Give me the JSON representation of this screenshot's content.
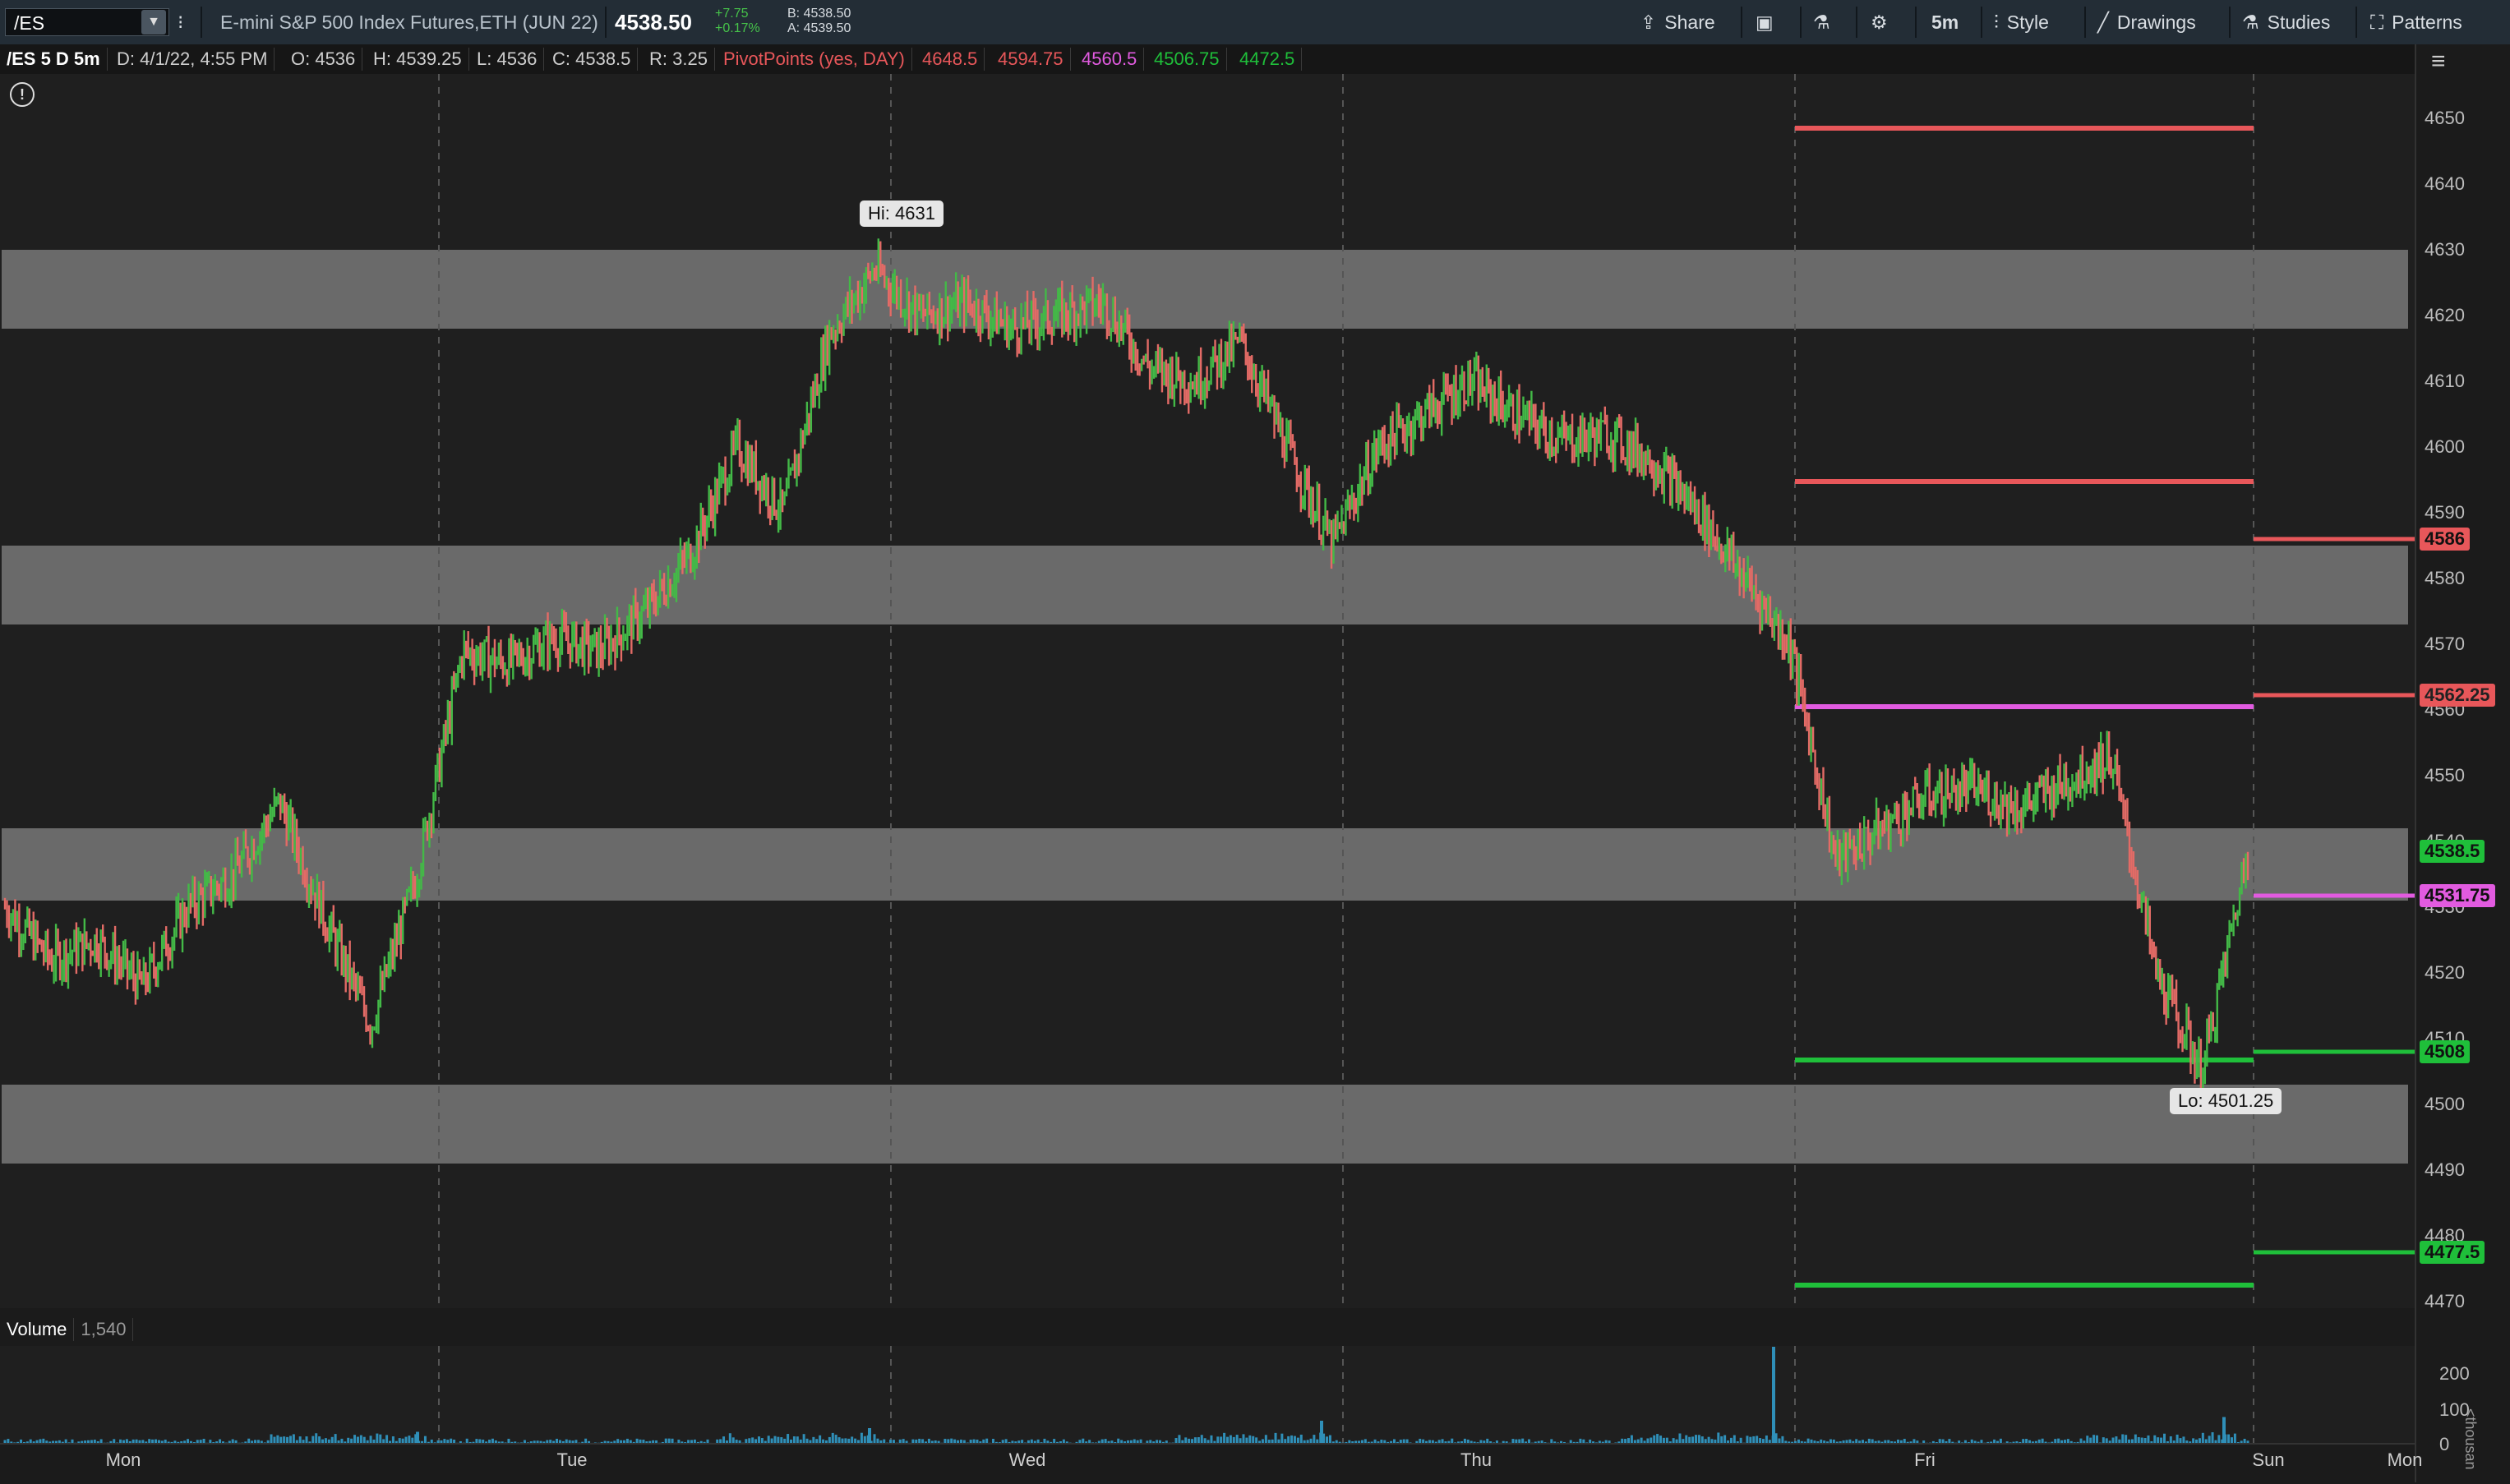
{
  "toolbar": {
    "symbol": "/ES",
    "instrument": "E-mini S&P 500 Index Futures,ETH (JUN 22)",
    "last_price": "4538.50",
    "change": "+7.75",
    "change_pct": "+0.17%",
    "bid": "B: 4538.50",
    "ask": "A: 4539.50",
    "share_label": "Share",
    "interval": "5m",
    "style_label": "Style",
    "drawings_label": "Drawings",
    "studies_label": "Studies",
    "patterns_label": "Patterns"
  },
  "infobar": {
    "chart_name": "/ES 5 D 5m",
    "date": "D: 4/1/22, 4:55 PM",
    "open": "O: 4536",
    "high": "H: 4539.25",
    "low": "L: 4536",
    "close": "C: 4538.5",
    "range": "R: 3.25",
    "study": "PivotPoints (yes, DAY)",
    "pivots": [
      "4648.5",
      "4594.75",
      "4560.5",
      "4506.75",
      "4472.5"
    ]
  },
  "colors": {
    "resistance": "#e8575a",
    "pivot": "#e25be0",
    "support": "#1fbf3a",
    "up_candle": "#43b947",
    "down_candle": "#e36b66",
    "zone": "#6a6a6a",
    "volume": "#2f8fb8"
  },
  "chart_data": {
    "type": "line",
    "title": "/ES 5 D 5m",
    "ylim": [
      4465,
      4655
    ],
    "y_ticks": [
      4470,
      4480,
      4490,
      4500,
      4510,
      4520,
      4530,
      4540,
      4550,
      4560,
      4570,
      4580,
      4590,
      4600,
      4610,
      4620,
      4630,
      4640,
      4650
    ],
    "x_labels": [
      "Mon",
      "Tue",
      "Wed",
      "Thu",
      "Fri",
      "Sun",
      "Mon"
    ],
    "series": [
      {
        "x": [
          "Mon 0.0",
          "Mon 0.1",
          "Mon 0.2",
          "Mon 0.3",
          "Mon 0.4",
          "Mon 0.5",
          "Mon 0.6",
          "Mon 0.7",
          "Mon 0.8",
          "Mon 0.9",
          "Tue 0.0",
          "Tue 0.1",
          "Tue 0.2",
          "Tue 0.3",
          "Tue 0.4",
          "Tue 0.5",
          "Tue 0.6",
          "Tue 0.7",
          "Tue 0.8",
          "Tue 0.9",
          "Wed 0.0",
          "Wed 0.1",
          "Wed 0.2",
          "Wed 0.3",
          "Wed 0.4",
          "Wed 0.5",
          "Wed 0.6",
          "Wed 0.7",
          "Wed 0.8",
          "Wed 0.9",
          "Thu 0.0",
          "Thu 0.1",
          "Thu 0.2",
          "Thu 0.3",
          "Thu 0.4",
          "Thu 0.5",
          "Thu 0.6",
          "Thu 0.7",
          "Thu 0.8",
          "Thu 0.9",
          "Fri 0.0",
          "Fri 0.1",
          "Fri 0.2",
          "Fri 0.3",
          "Fri 0.4",
          "Fri 0.5",
          "Fri 0.6",
          "Fri 0.7",
          "Fri 0.8",
          "Fri 0.9"
        ],
        "values": [
          4530,
          4522,
          4525,
          4518,
          4530,
          4535,
          4546,
          4528,
          4512,
          4535,
          4569,
          4567,
          4571,
          4569,
          4575,
          4584,
          4600,
          4590,
          4617,
          4627,
          4620,
          4622,
          4618,
          4620,
          4622,
          4612,
          4610,
          4616,
          4600,
          4585,
          4600,
          4605,
          4610,
          4605,
          4601,
          4602,
          4598,
          4590,
          4580,
          4570,
          4537,
          4542,
          4547,
          4548,
          4545,
          4549,
          4553,
          4520,
          4505,
          4538.5
        ]
      }
    ],
    "price_markers": [
      4586,
      4562.25,
      4538.5,
      4531.75,
      4508,
      4477.5
    ],
    "zones": [
      [
        4618,
        4630
      ],
      [
        4573,
        4585
      ],
      [
        4531,
        4542
      ],
      [
        4491,
        4503
      ]
    ],
    "pivot_lines_friday": [
      4648.5,
      4594.75,
      4560.5,
      4506.75,
      4472.5
    ],
    "pivot_lines_next": [
      4586,
      4562.25,
      4531.75,
      4508,
      4477.5
    ],
    "hi_label": "Hi: 4631",
    "lo_label": "Lo: 4501.25",
    "volume_label": "Volume",
    "volume_value": "1,540",
    "volume_ticks": [
      "200",
      "100",
      "0"
    ],
    "volume_unit": "<thousan"
  }
}
